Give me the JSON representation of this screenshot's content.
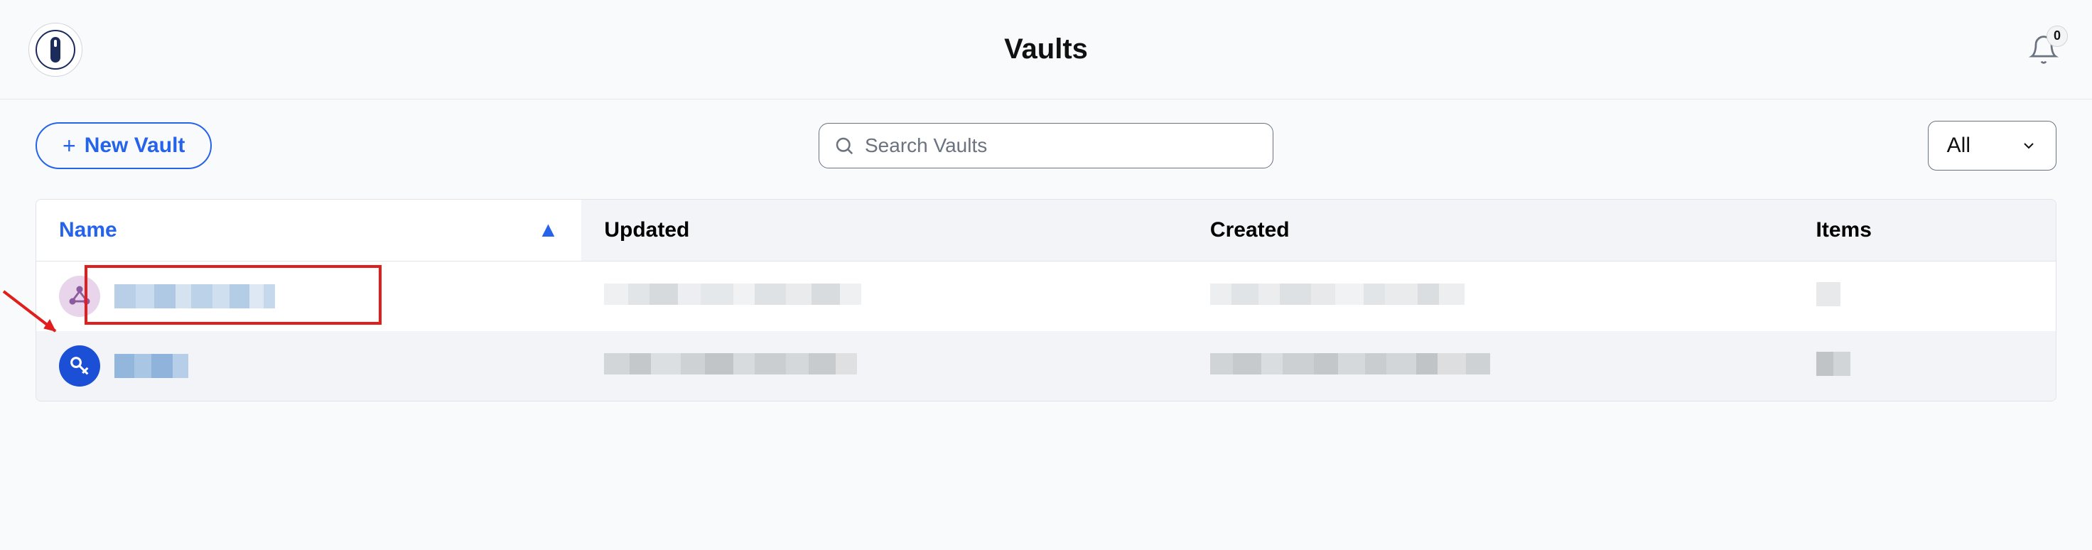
{
  "header": {
    "page_title": "Vaults",
    "notification_count": "0"
  },
  "toolbar": {
    "new_vault_label": "New Vault",
    "search_placeholder": "Search Vaults",
    "filter_selected": "All"
  },
  "table": {
    "columns": {
      "name": "Name",
      "updated": "Updated",
      "created": "Created",
      "items": "Items"
    },
    "sort": {
      "column": "name",
      "direction": "asc"
    },
    "rows": [
      {
        "icon_type": "shared",
        "icon_bg": "#e8d5ec",
        "icon_fg": "#8b5a9f",
        "name_redacted": true,
        "updated_redacted": true,
        "created_redacted": true,
        "items_redacted": true,
        "highlighted": true
      },
      {
        "icon_type": "personal",
        "icon_bg": "#1a4fd6",
        "icon_fg": "#ffffff",
        "name_redacted": true,
        "updated_redacted": true,
        "created_redacted": true,
        "items_redacted": true,
        "highlighted": false
      }
    ]
  },
  "annotation": {
    "type": "highlight-arrow",
    "target": "first-vault-row"
  }
}
